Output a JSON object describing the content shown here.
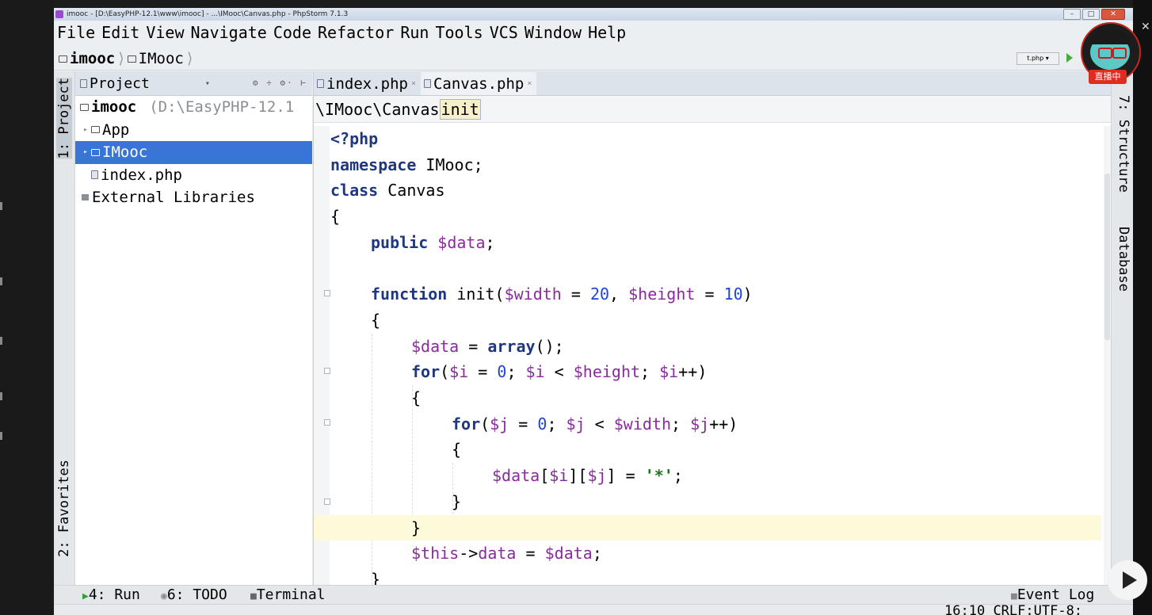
{
  "window": {
    "title": "imooc - [D:\\EasyPHP-12.1\\www\\imooc] - ...\\IMooc\\Canvas.php - PhpStorm 7.1.3"
  },
  "menu": [
    "File",
    "Edit",
    "View",
    "Navigate",
    "Code",
    "Refactor",
    "Run",
    "Tools",
    "VCS",
    "Window",
    "Help"
  ],
  "navbar": {
    "root": "imooc",
    "folder": "IMooc",
    "run_config": "t.php ▾"
  },
  "left_strip": {
    "project_tab": "1: Project",
    "favorites_tab": "2: Favorites"
  },
  "project": {
    "header": "Project",
    "tree": [
      {
        "label": "imooc",
        "path": "(D:\\EasyPHP-12.1"
      },
      {
        "label": "App"
      },
      {
        "label": "IMooc"
      },
      {
        "label": "index.php"
      },
      {
        "label": "External Libraries"
      }
    ]
  },
  "editor": {
    "tabs": [
      "index.php",
      "Canvas.php"
    ],
    "breadcrumb": {
      "class": "\\IMooc\\Canvas",
      "method": "init"
    },
    "code": {
      "l1": "<?php",
      "l2_kw": "namespace",
      "l2_rest": " IMooc;",
      "l3_kw": "class",
      "l3_rest": " Canvas",
      "l4": "{",
      "l5_kw": "public",
      "l5_var": "$data",
      "l5_end": ";",
      "l7_kw": "function",
      "l7_name": " init(",
      "l7_v1": "$width",
      "l7_eq1": " = ",
      "l7_n1": "20",
      "l7_c": ", ",
      "l7_v2": "$height",
      "l7_eq2": " = ",
      "l7_n2": "10",
      "l7_end": ")",
      "l8": "{",
      "l9_var": "$data",
      "l9_eq": " = ",
      "l9_kw": "array",
      "l9_end": "();",
      "l10_kw": "for",
      "l10_a": "(",
      "l10_v1": "$i",
      "l10_b": " = ",
      "l10_n": "0",
      "l10_c": "; ",
      "l10_v2": "$i",
      "l10_d": " < ",
      "l10_v3": "$height",
      "l10_e": "; ",
      "l10_v4": "$i",
      "l10_f": "++)",
      "l11": "{",
      "l12_kw": "for",
      "l12_a": "(",
      "l12_v1": "$j",
      "l12_b": " = ",
      "l12_n": "0",
      "l12_c": "; ",
      "l12_v2": "$j",
      "l12_d": " < ",
      "l12_v3": "$width",
      "l12_e": "; ",
      "l12_v4": "$j",
      "l12_f": "++)",
      "l13": "{",
      "l14_v1": "$data",
      "l14_a": "[",
      "l14_v2": "$i",
      "l14_b": "][",
      "l14_v3": "$j",
      "l14_c": "] = ",
      "l14_s": "'*'",
      "l14_end": ";",
      "l15": "}",
      "l16": "}",
      "l17_v1": "$this",
      "l17_a": "->",
      "l17_v2": "data",
      "l17_b": " = ",
      "l17_v3": "$data",
      "l17_end": ";",
      "l18": "}"
    }
  },
  "right_strip": {
    "structure_tab": "7: Structure",
    "database_tab": "Database"
  },
  "bottom_tools": {
    "run": "4: Run",
    "todo": "6: TODO",
    "terminal": "Terminal",
    "event_log": "Event Log"
  },
  "status": {
    "position": "16:10",
    "line_sep": "CRLF:",
    "encoding": "UTF-8:"
  },
  "overlay": {
    "live_badge": "直播中",
    "close": "✕"
  },
  "colors": {
    "selection": "#3875d6",
    "current_line": "#fcfad8",
    "keyword": "#1f377f",
    "variable": "#8b2a9e",
    "number": "#1d45d9",
    "string": "#1a7a1a"
  }
}
